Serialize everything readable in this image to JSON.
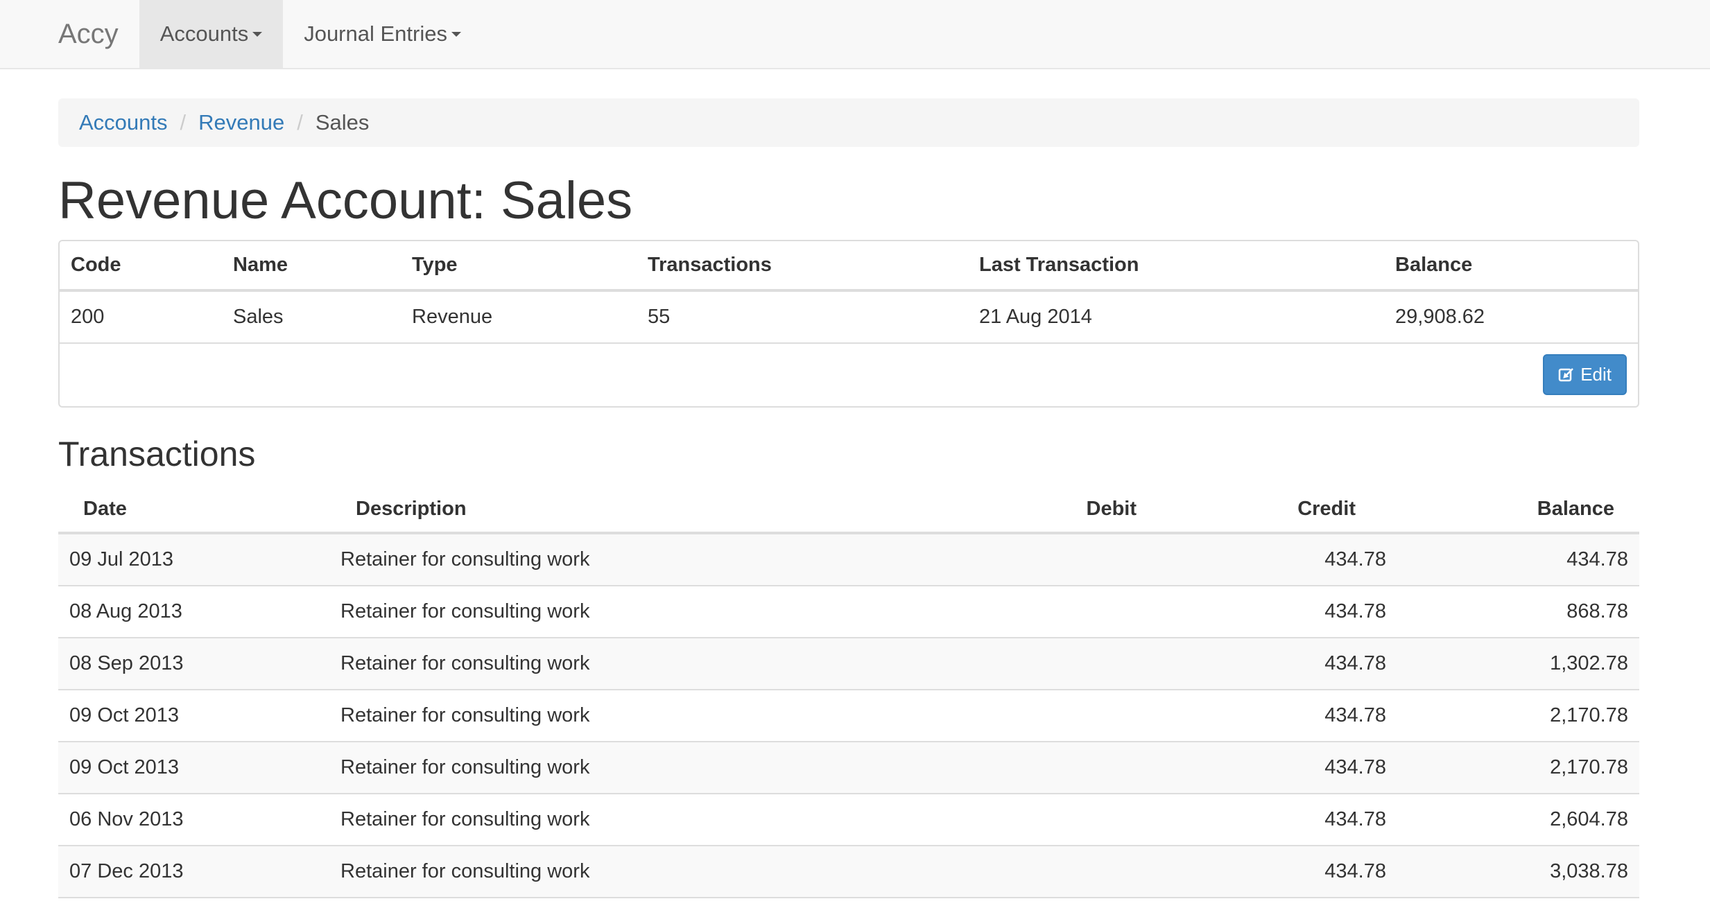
{
  "navbar": {
    "brand": "Accy",
    "items": [
      {
        "label": "Accounts",
        "active": true
      },
      {
        "label": "Journal Entries",
        "active": false
      }
    ]
  },
  "breadcrumb": {
    "items": [
      "Accounts",
      "Revenue"
    ],
    "current": "Sales",
    "separator": "/"
  },
  "page_title": "Revenue Account: Sales",
  "summary": {
    "headers": [
      "Code",
      "Name",
      "Type",
      "Transactions",
      "Last Transaction",
      "Balance"
    ],
    "row": [
      "200",
      "Sales",
      "Revenue",
      "55",
      "21 Aug 2014",
      "29,908.62"
    ],
    "edit_label": "Edit"
  },
  "transactions": {
    "title": "Transactions",
    "headers": [
      "Date",
      "Description",
      "Debit",
      "Credit",
      "Balance"
    ],
    "rows": [
      [
        "09 Jul 2013",
        "Retainer for consulting work",
        "",
        "434.78",
        "434.78"
      ],
      [
        "08 Aug 2013",
        "Retainer for consulting work",
        "",
        "434.78",
        "868.78"
      ],
      [
        "08 Sep 2013",
        "Retainer for consulting work",
        "",
        "434.78",
        "1,302.78"
      ],
      [
        "09 Oct 2013",
        "Retainer for consulting work",
        "",
        "434.78",
        "2,170.78"
      ],
      [
        "09 Oct 2013",
        "Retainer for consulting work",
        "",
        "434.78",
        "2,170.78"
      ],
      [
        "06 Nov 2013",
        "Retainer for consulting work",
        "",
        "434.78",
        "2,604.78"
      ],
      [
        "07 Dec 2013",
        "Retainer for consulting work",
        "",
        "434.78",
        "3,038.78"
      ]
    ]
  },
  "colors": {
    "link": "#337ab7",
    "primary_button": "#428bca",
    "navbar_bg": "#f8f8f8"
  }
}
